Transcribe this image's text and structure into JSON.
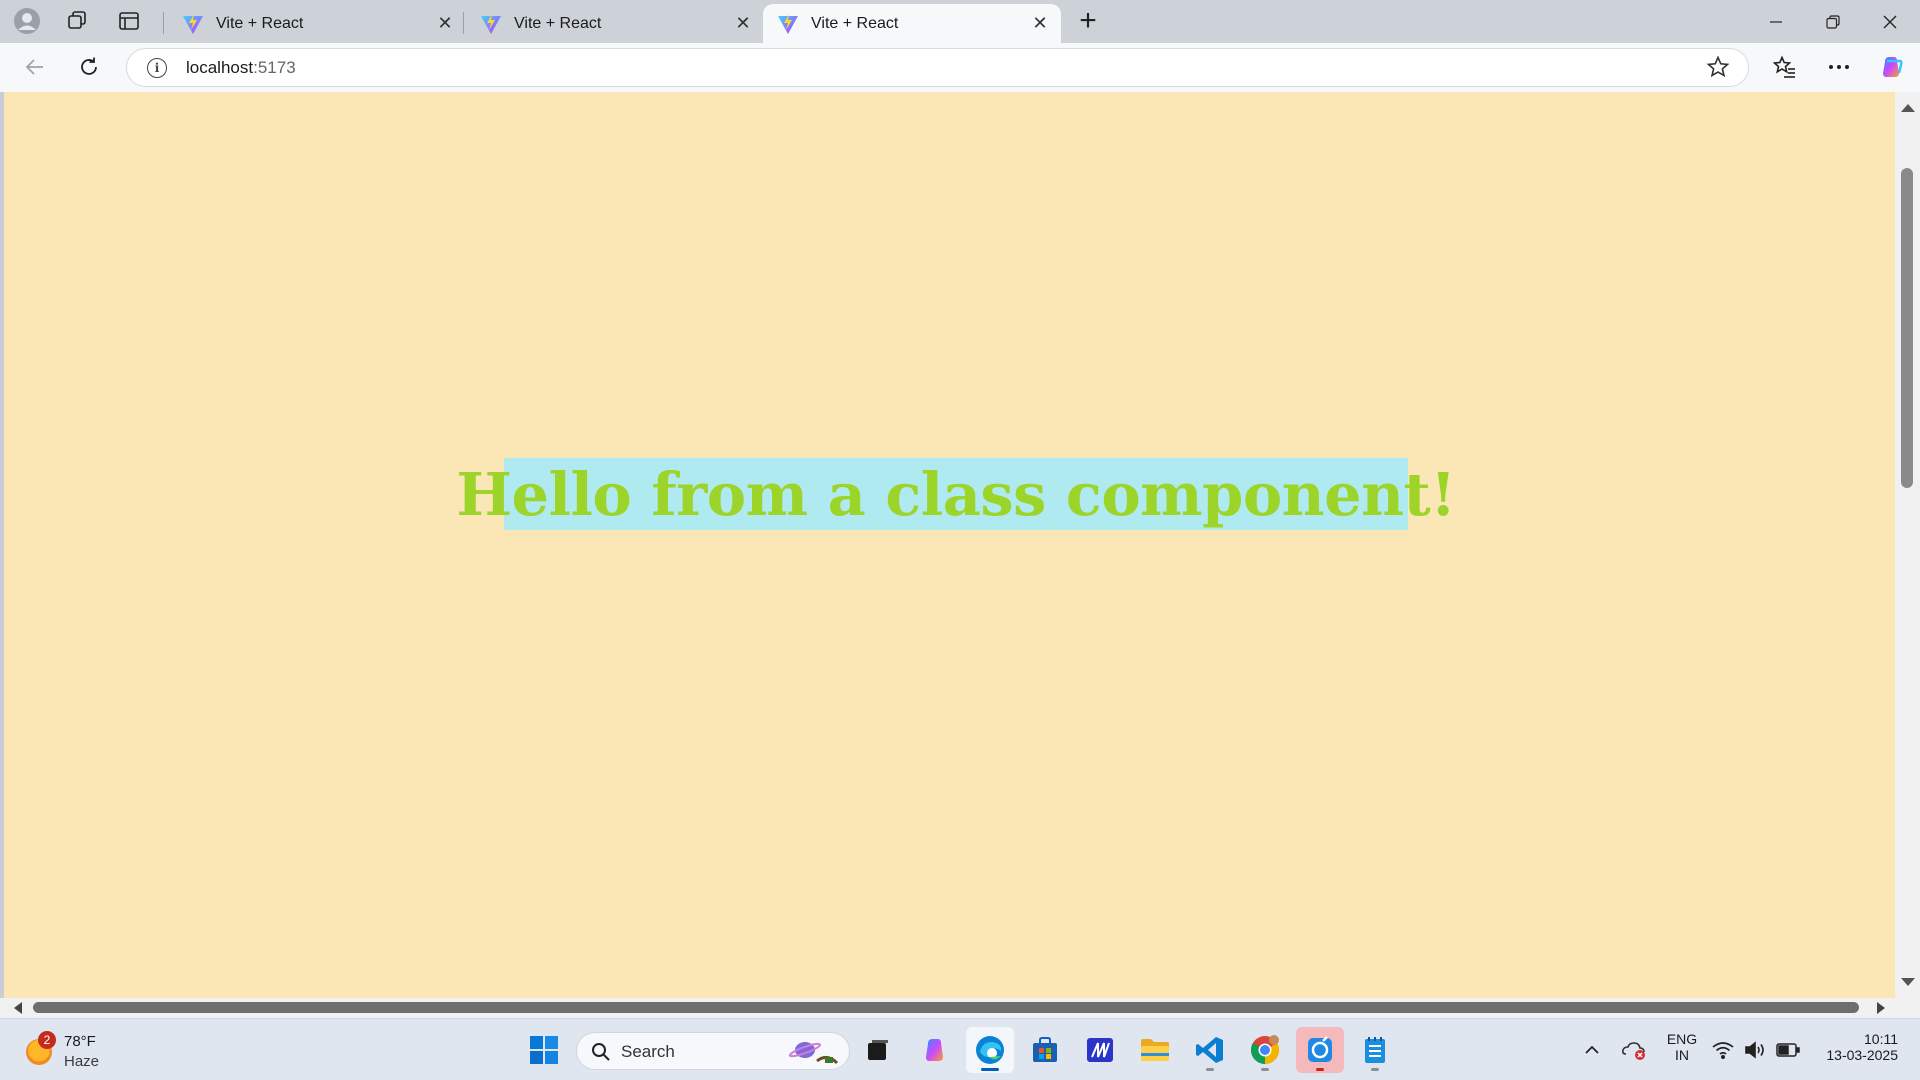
{
  "browser": {
    "tabs": [
      {
        "title": "Vite + React",
        "active": false
      },
      {
        "title": "Vite + React",
        "active": false
      },
      {
        "title": "Vite + React",
        "active": true
      }
    ],
    "address": {
      "host": "localhost",
      "port": ":5173"
    }
  },
  "page": {
    "heading": "Hello from a class component!",
    "colors": {
      "background": "#fbe6b6",
      "heading_bg": "#aeeaf0",
      "heading_text": "#9dd42a"
    }
  },
  "taskbar": {
    "weather": {
      "temp": "78°F",
      "condition": "Haze",
      "badge": "2"
    },
    "search_label": "Search",
    "apps": [
      "start",
      "search",
      "task-view",
      "copilot",
      "edge",
      "store",
      "app",
      "file-explorer",
      "vscode",
      "chrome",
      "app",
      "notepad"
    ],
    "tray": {
      "lang_line1": "ENG",
      "lang_line2": "IN",
      "time": "10:11",
      "date": "13-03-2025"
    }
  }
}
